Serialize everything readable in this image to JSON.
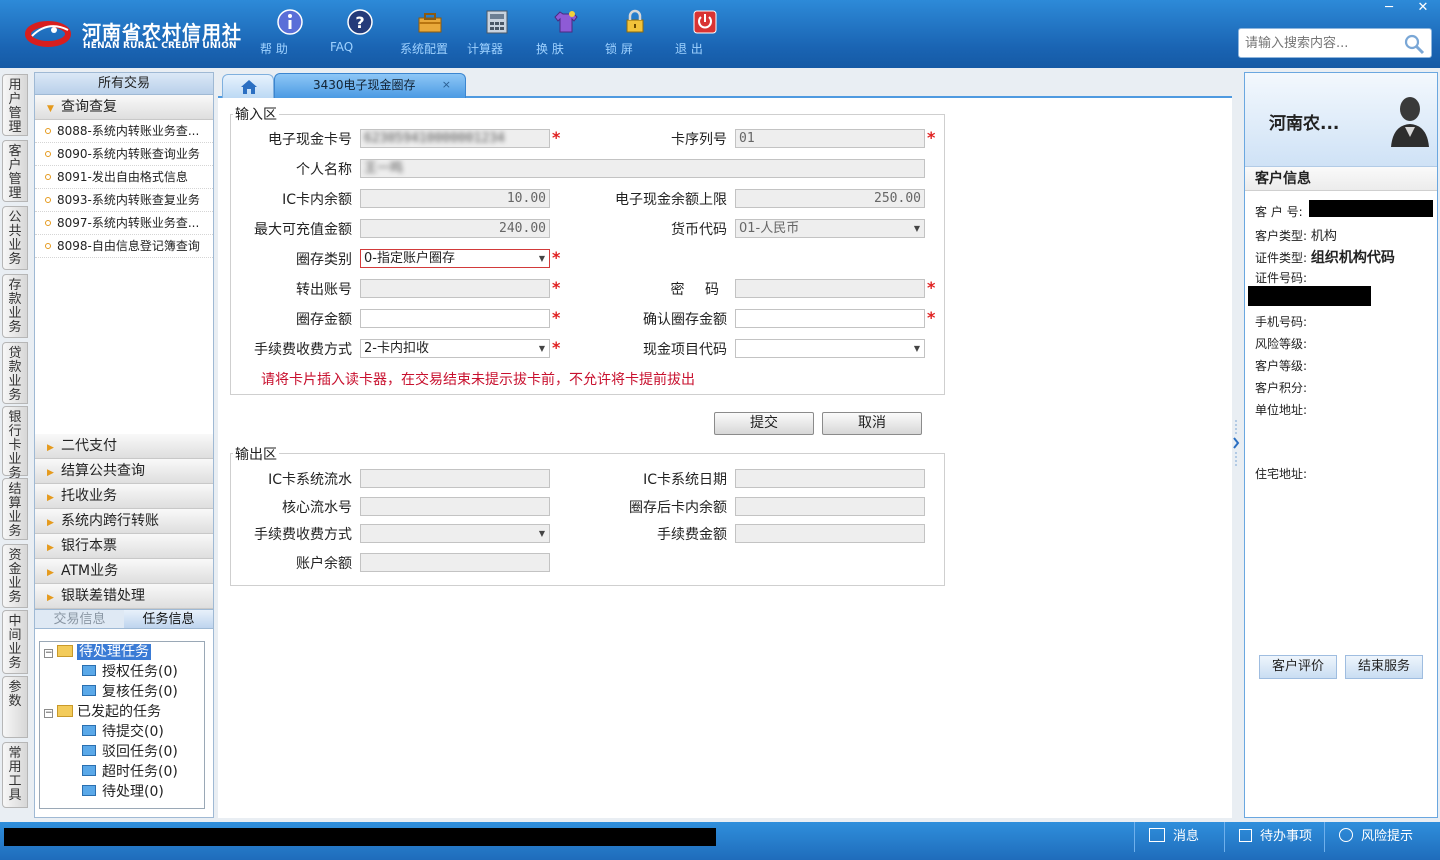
{
  "header": {
    "logo_cn": "河南省农村信用社",
    "logo_en": "HENAN RURAL CREDIT UNION",
    "tools": [
      {
        "label": "帮 助",
        "icon": "info-icon"
      },
      {
        "label": "FAQ",
        "icon": "question-icon"
      },
      {
        "label": "系统配置",
        "icon": "toolbox-icon"
      },
      {
        "label": "计算器",
        "icon": "calculator-icon"
      },
      {
        "label": "换 肤",
        "icon": "shirt-icon"
      },
      {
        "label": "锁 屏",
        "icon": "lock-icon"
      },
      {
        "label": "退 出",
        "icon": "power-icon"
      }
    ],
    "search_placeholder": "请输入搜索内容...",
    "window_minimize": "─",
    "window_close": "✕"
  },
  "vstrip": [
    "用户管理",
    "客户管理",
    "公共业务",
    "存款业务",
    "贷款业务",
    "银行卡业务",
    "结算业务",
    "资金业务",
    "中间业务",
    "参数",
    "常用工具"
  ],
  "leftnav": {
    "title": "所有交易",
    "open_group": "查询查复",
    "items": [
      "8088-系统内转账业务查...",
      "8090-系统内转账查询业务",
      "8091-发出自由格式信息",
      "8093-系统内转账查复业务",
      "8097-系统内转账业务查...",
      "8098-自由信息登记簿查询"
    ],
    "groups": [
      "二代支付",
      "结算公共查询",
      "托收业务",
      "系统内跨行转账",
      "银行本票",
      "ATM业务",
      "银联差错处理"
    ],
    "tabs": {
      "trade": "交易信息",
      "task": "任务信息"
    },
    "tree": {
      "pending": "待处理任务",
      "pending_children": [
        "授权任务(0)",
        "复核任务(0)"
      ],
      "started": "已发起的任务",
      "started_children": [
        "待提交(0)",
        "驳回任务(0)",
        "超时任务(0)",
        "待处理(0)"
      ]
    }
  },
  "tabs": {
    "active": "3430电子现金圈存",
    "close": "×"
  },
  "form": {
    "input_section": "输入区",
    "output_section": "输出区",
    "labels": {
      "card_no": "电子现金卡号",
      "card_seq": "卡序列号",
      "name": "个人名称",
      "ic_balance": "IC卡内余额",
      "cash_limit": "电子现金余额上限",
      "max_recharge": "最大可充值金额",
      "currency": "货币代码",
      "load_type": "圈存类别",
      "out_account": "转出账号",
      "password": "密 码",
      "load_amount": "圈存金额",
      "confirm_amount": "确认圈存金额",
      "fee_method": "手续费收费方式",
      "cash_item": "现金项目代码",
      "ic_serial": "IC卡系统流水",
      "ic_date": "IC卡系统日期",
      "core_serial": "核心流水号",
      "after_balance": "圈存后卡内余额",
      "out_fee_method": "手续费收费方式",
      "fee_amount": "手续费金额",
      "account_balance": "账户余额"
    },
    "values": {
      "card_no": "623059410000001234",
      "card_seq": "01",
      "name": "王一鸣",
      "ic_balance": "10.00",
      "cash_limit": "250.00",
      "max_recharge": "240.00",
      "currency": "01-人民币",
      "load_type": "0-指定账户圈存",
      "fee_method": "2-卡内扣收"
    },
    "warning": "请将卡片插入读卡器，在交易结束未提示拔卡前，不允许将卡提前拔出",
    "submit": "提交",
    "cancel": "取消"
  },
  "customer": {
    "name": "河南农...",
    "info_title": "客户信息",
    "fields": {
      "customer_no": "客 户 号:",
      "customer_type": "客户类型:",
      "customer_type_val": "机构",
      "id_type": "证件类型:",
      "id_type_val": "组织机构代码",
      "id_no": "证件号码:",
      "mobile": "手机号码:",
      "risk_level": "风险等级:",
      "customer_level": "客户等级:",
      "points": "客户积分:",
      "work_address": "单位地址:",
      "home_address": "住宅地址:"
    },
    "evaluate": "客户评价",
    "end_service": "结束服务"
  },
  "statusbar": {
    "messages": "消息",
    "todo": "待办事项",
    "risk": "风险提示"
  }
}
